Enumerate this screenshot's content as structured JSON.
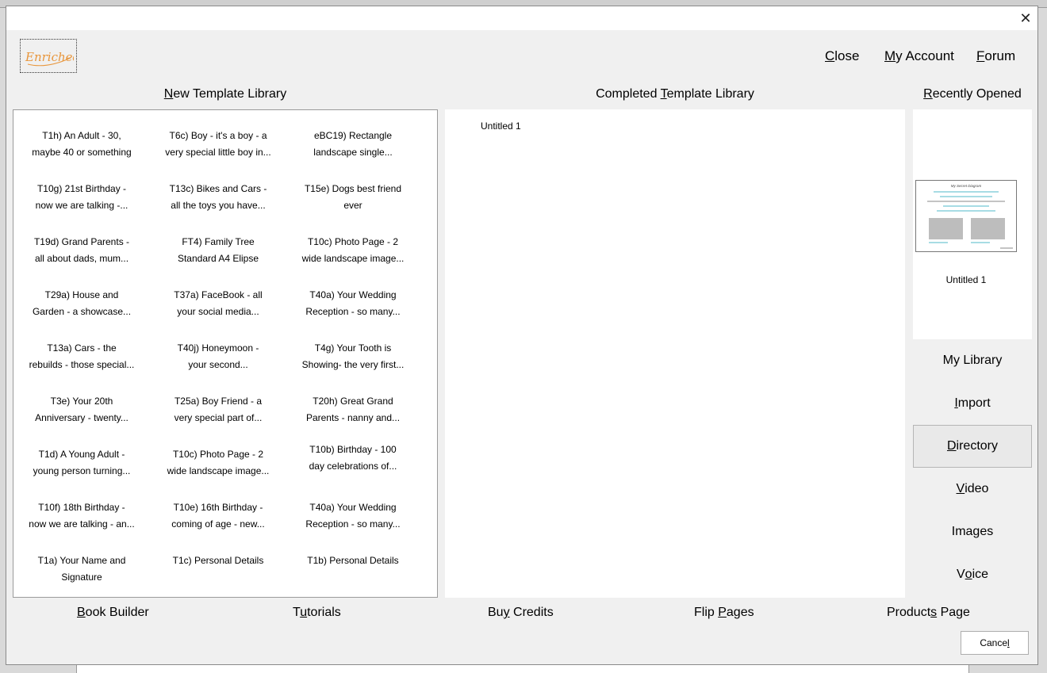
{
  "dialog": {
    "close_glyph": "✕",
    "logo_text": "Enriched",
    "top_links": [
      {
        "pre": "",
        "ul": "C",
        "post": "lose"
      },
      {
        "pre": "",
        "ul": "M",
        "post": "y Account"
      },
      {
        "pre": "",
        "ul": "F",
        "post": "orum"
      }
    ],
    "section_titles": {
      "new": {
        "pre": "",
        "ul": "N",
        "post": "ew Template Library"
      },
      "completed": {
        "pre": "Completed ",
        "ul": "T",
        "post": "emplate Library"
      },
      "recent": {
        "pre": "",
        "ul": "R",
        "post": "ecently Opened"
      }
    },
    "templates": [
      [
        "T1h) An Adult - 30,",
        "maybe 40 or something"
      ],
      [
        "T6c) Boy - it's a boy - a",
        "very special little boy in..."
      ],
      [
        "eBC19) Rectangle",
        "landscape single..."
      ],
      [
        "T10g) 21st Birthday -",
        "now we are talking -..."
      ],
      [
        "T13c) Bikes and Cars -",
        "all the toys you have..."
      ],
      [
        "T15e) Dogs best friend",
        "ever"
      ],
      [
        "T19d) Grand Parents -",
        "all about dads, mum..."
      ],
      [
        "FT4) Family Tree",
        "Standard A4 Elipse"
      ],
      [
        "T10c) Photo Page - 2",
        "wide landscape image..."
      ],
      [
        "T29a) House and",
        "Garden - a showcase..."
      ],
      [
        "T37a) FaceBook - all",
        "your social media..."
      ],
      [
        "T40a) Your Wedding",
        "Reception - so many..."
      ],
      [
        "T13a) Cars - the",
        "rebuilds - those special..."
      ],
      [
        "T40j) Honeymoon -",
        "your second..."
      ],
      [
        "T4g) Your Tooth is",
        "Showing- the very first..."
      ],
      [
        "T3e) Your 20th",
        "Anniversary - twenty..."
      ],
      [
        "T25a) Boy Friend - a",
        "very special part of..."
      ],
      [
        "T20h) Great Grand",
        "Parents - nanny and..."
      ],
      [
        "T1d) A Young Adult -",
        "young person turning..."
      ],
      [
        "T10c) Photo Page - 2",
        "wide landscape image..."
      ],
      [
        "T10b) Birthday - 100",
        "day celebrations of..."
      ],
      [
        "T10f) 18th Birthday -",
        "now we are talking - an..."
      ],
      [
        "T10e) 16th Birthday -",
        "coming of age - new..."
      ],
      [
        "T40a) Your Wedding",
        "Reception - so many..."
      ],
      [
        "T1a) Your Name and",
        "Signature"
      ],
      [
        "T1c) Personal Details",
        ""
      ],
      [
        "T1b) Personal Details",
        ""
      ]
    ],
    "completed_items": [
      "Untitled 1"
    ],
    "recent_items": [
      {
        "label": "Untitled 1",
        "thumb_title": "My Secret Diagram"
      }
    ],
    "side_buttons": [
      {
        "pre": "My Library",
        "ul": "",
        "post": "",
        "selected": false
      },
      {
        "pre": "",
        "ul": "I",
        "post": "mport",
        "selected": false
      },
      {
        "pre": "",
        "ul": "D",
        "post": "irectory",
        "selected": true
      },
      {
        "pre": "",
        "ul": "V",
        "post": "ideo",
        "selected": false
      },
      {
        "pre": "Ima",
        "ul": "g",
        "post": "es",
        "selected": false
      },
      {
        "pre": "V",
        "ul": "o",
        "post": "ice",
        "selected": false
      }
    ],
    "bottom_links": [
      {
        "pre": "",
        "ul": "B",
        "post": "ook Builder"
      },
      {
        "pre": "T",
        "ul": "u",
        "post": "torials"
      },
      {
        "pre": "Bu",
        "ul": "y",
        "post": " Credits"
      },
      {
        "pre": "Flip ",
        "ul": "P",
        "post": "ages"
      },
      {
        "pre": "Product",
        "ul": "s",
        "post": " Page"
      }
    ],
    "cancel": {
      "pre": "Cance",
      "ul": "l",
      "post": ""
    },
    "colors": {
      "logo": "#e8963c",
      "dialog_bg": "#f0f0f0"
    }
  }
}
